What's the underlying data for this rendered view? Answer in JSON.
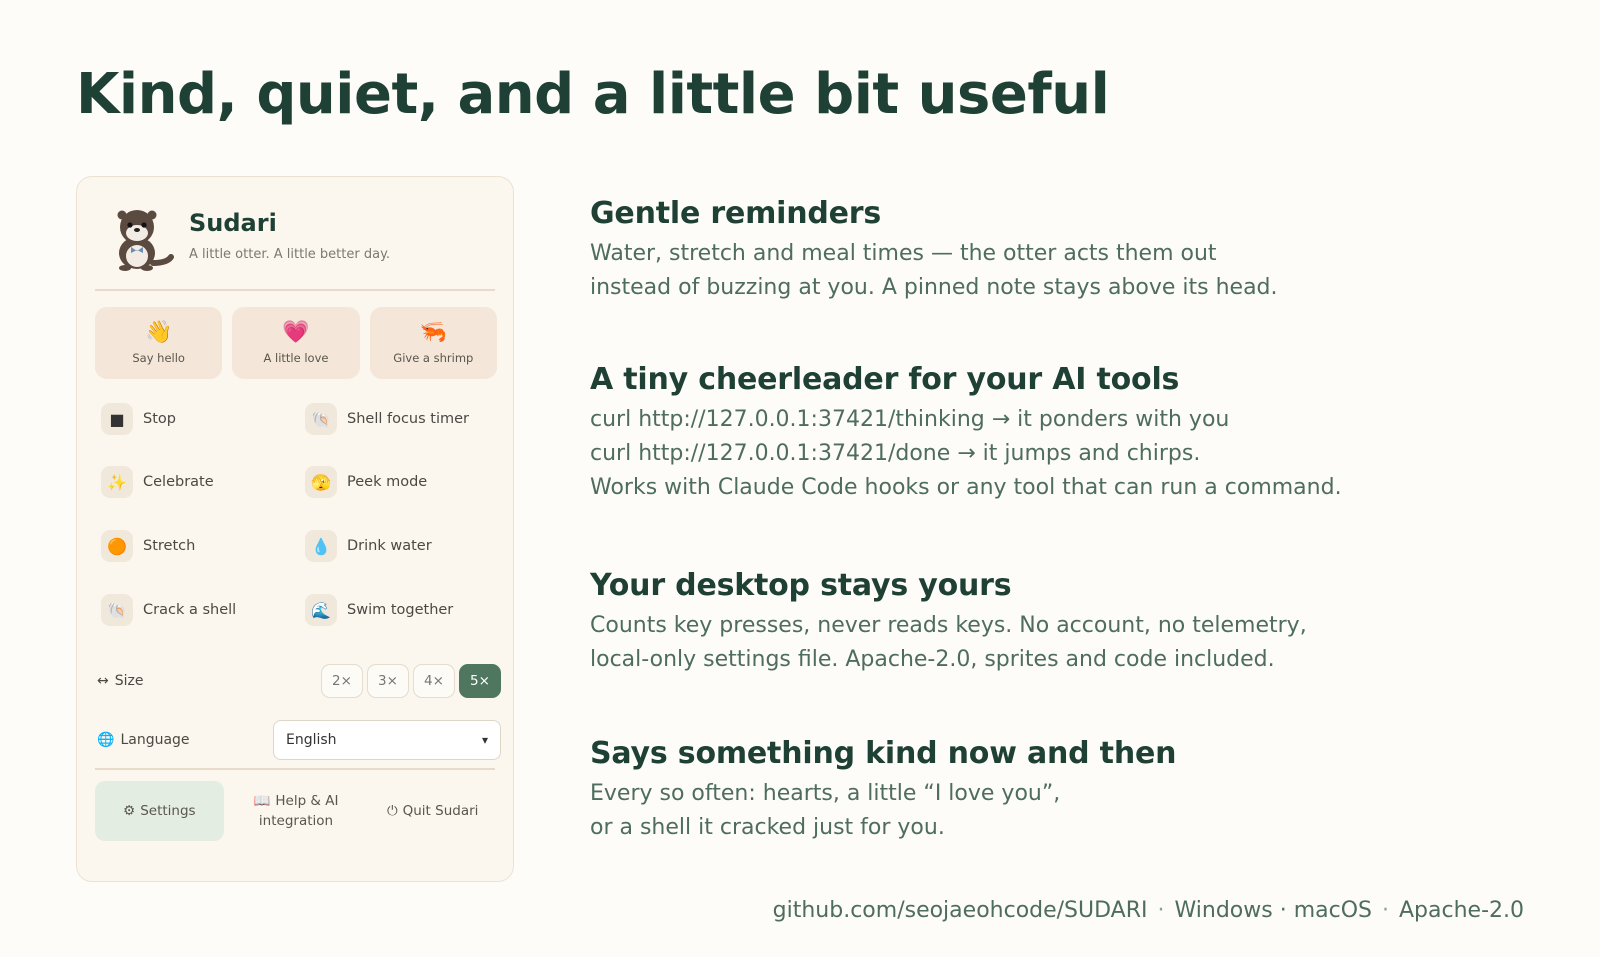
{
  "headline": "Kind, quiet, and a little bit useful",
  "panel": {
    "app_name": "Sudari",
    "tagline": "A little otter. A little better day.",
    "quick_actions": [
      {
        "icon": "👋",
        "label": "Say hello"
      },
      {
        "icon": "💗",
        "label": "A little love"
      },
      {
        "icon": "🦐",
        "label": "Give a shrimp"
      }
    ],
    "actions": [
      {
        "icon": "■",
        "label": "Stop"
      },
      {
        "icon": "🐚",
        "label": "Shell focus timer"
      },
      {
        "icon": "✨",
        "label": "Celebrate"
      },
      {
        "icon": "🫣",
        "label": "Peek mode"
      },
      {
        "icon": "🟠",
        "label": "Stretch"
      },
      {
        "icon": "💧",
        "label": "Drink water"
      },
      {
        "icon": "🐚",
        "label": "Crack a shell"
      },
      {
        "icon": "🌊",
        "label": "Swim together"
      }
    ],
    "size": {
      "icon": "↔",
      "label": "Size",
      "options": [
        "2×",
        "3×",
        "4×",
        "5×"
      ],
      "selected": "5×"
    },
    "language": {
      "icon": "🌐",
      "label": "Language",
      "value": "English"
    },
    "footer": {
      "settings": {
        "icon": "⚙",
        "label": "Settings"
      },
      "help": {
        "icon": "📖",
        "label_line1": "Help & AI",
        "label_line2": "integration"
      },
      "quit": {
        "icon": "⏻",
        "label": "Quit Sudari"
      }
    }
  },
  "features": [
    {
      "title": "Gentle reminders",
      "lines": [
        "Water, stretch and meal times — the otter acts them out",
        "instead of buzzing at you. A pinned note stays above its head."
      ]
    },
    {
      "title": "A tiny cheerleader for your AI tools",
      "lines": [
        "curl http://127.0.0.1:37421/thinking → it ponders with you",
        "curl http://127.0.0.1:37421/done → it jumps and chirps.",
        "Works with Claude Code hooks or any tool that can run a command."
      ]
    },
    {
      "title": "Your desktop stays yours",
      "lines": [
        "Counts key presses, never reads keys. No account, no telemetry,",
        "local-only settings file. Apache-2.0, sprites and code included."
      ]
    },
    {
      "title": "Says something kind now and then",
      "lines": [
        "Every so often: hearts, a little “I love you”,",
        "or a shell it cracked just for you."
      ]
    }
  ],
  "footer_line": {
    "repo": "github.com/seojaeohcode/SUDARI",
    "separator": "·",
    "platforms": "Windows · macOS",
    "license": "Apache-2.0"
  }
}
